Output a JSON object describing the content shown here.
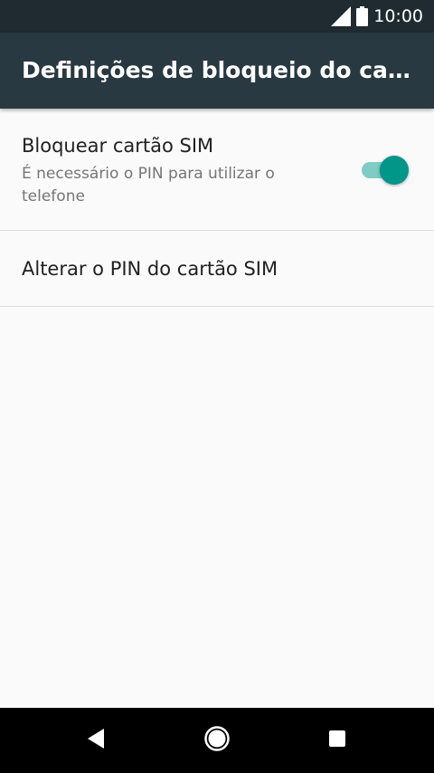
{
  "status_bar": {
    "time": "10:00",
    "icons": [
      "signal-icon",
      "battery-icon"
    ]
  },
  "app_bar": {
    "title": "Definições de bloqueio do cartão SIM"
  },
  "preferences": {
    "lock_sim": {
      "title": "Bloquear cartão SIM",
      "summary": "É necessário o PIN para utilizar o telefone",
      "enabled": true
    },
    "change_pin": {
      "title": "Alterar o PIN do cartão SIM"
    }
  },
  "navigation": {
    "icons": [
      "back-icon",
      "home-icon",
      "recent-apps-icon"
    ]
  },
  "colors": {
    "status_bar": "#1f2b31",
    "app_bar": "#293941",
    "accent": "#009688",
    "toggle_track": "#80cbc4",
    "background": "#fafafa"
  }
}
